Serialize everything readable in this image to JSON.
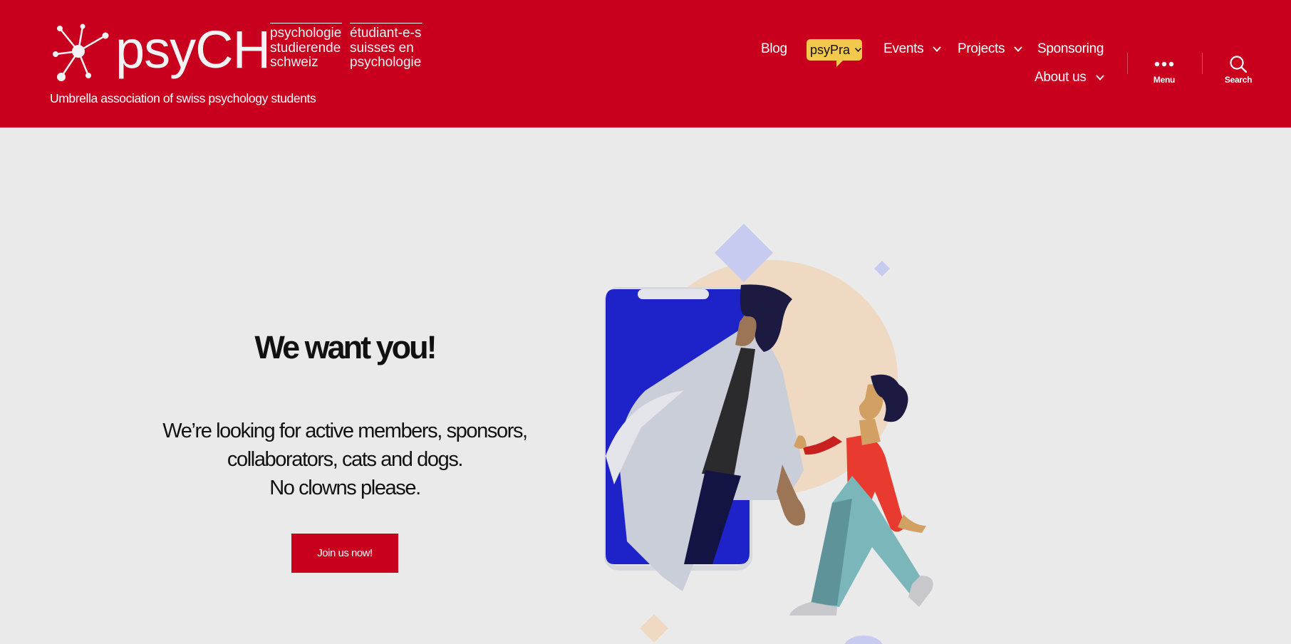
{
  "brand": {
    "wordmark": "psyCH",
    "col1": [
      "psychologie",
      "studierende",
      "schweiz"
    ],
    "col2": [
      "étudiant-e-s",
      "suisses en",
      "psychologie"
    ],
    "tagline": "Umbrella association of swiss psychology students"
  },
  "nav": {
    "blog": "Blog",
    "psypra": "psyPra",
    "events": "Events",
    "projects": "Projects",
    "sponsoring": "Sponsoring",
    "about": "About us"
  },
  "toggles": {
    "menu": "Menu",
    "search": "Search"
  },
  "hero": {
    "title": "We want you!",
    "line1": "We’re looking for active members, sponsors,",
    "line2": "collaborators, cats and dogs.",
    "line3": "No clowns please.",
    "cta": "Join us now!"
  },
  "colors": {
    "brand_red": "#c8001e",
    "badge_yellow": "#f2c94c",
    "page_bg": "#eaeaea"
  },
  "icons": [
    "molecule-logo-icon",
    "chevron-down-icon",
    "ellipsis-icon",
    "search-icon"
  ]
}
